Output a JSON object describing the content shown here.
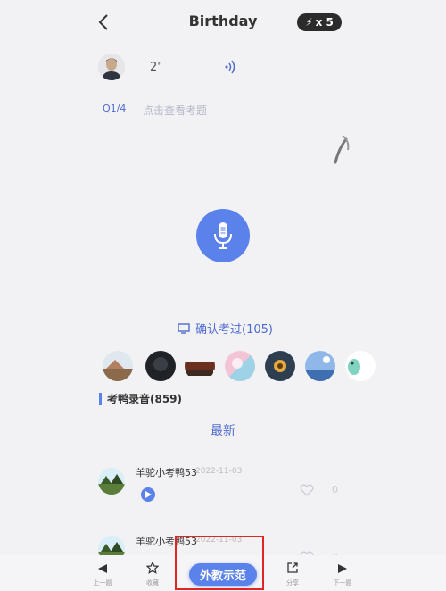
{
  "header": {
    "title": "Birthday",
    "speed_label": "x 5"
  },
  "prompt": {
    "duration": "2\"",
    "question_index": "Q1/4",
    "question_hint": "点击查看考题"
  },
  "confirm": {
    "label": "确认考过(105)"
  },
  "recordings": {
    "section_title": "考鸭录音(859)",
    "sort_label": "最新",
    "items": [
      {
        "name": "羊驼小考鸭53",
        "date": "2022-11-03",
        "likes": "0"
      },
      {
        "name": "羊驼小考鸭53",
        "date": "2022-11-03",
        "likes": "0"
      }
    ]
  },
  "bottom_nav": {
    "prev_label": "上一题",
    "favorite_label": "收藏",
    "teacher_demo_label": "外教示范",
    "share_label": "分享",
    "next_label": "下一题"
  },
  "colors": {
    "accent": "#5a82ea",
    "highlight_frame": "#e12424",
    "background": "#f2f2f4"
  }
}
